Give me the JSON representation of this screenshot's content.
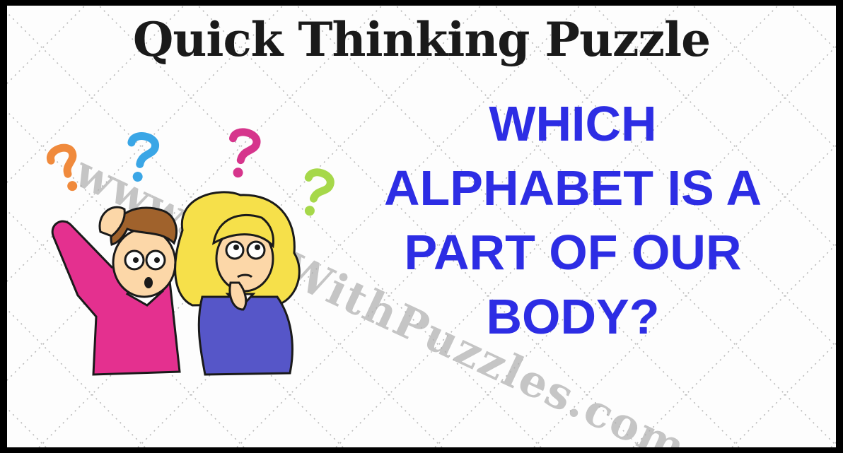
{
  "title": "Quick Thinking Puzzle",
  "question_lines": [
    "WHICH",
    "ALPHABET IS A",
    "PART OF OUR",
    "BODY?"
  ],
  "watermark": "www.FunWithPuzzles.com",
  "colors": {
    "background": "#fdfdfd",
    "border": "#000000",
    "title": "#1a1a1a",
    "question": "#2d2de4",
    "watermark": "#969696"
  },
  "illustration": {
    "icons": [
      "question-mark-orange",
      "question-mark-blue",
      "question-mark-magenta",
      "question-mark-green"
    ],
    "figures": [
      "confused-boy",
      "confused-girl"
    ]
  }
}
